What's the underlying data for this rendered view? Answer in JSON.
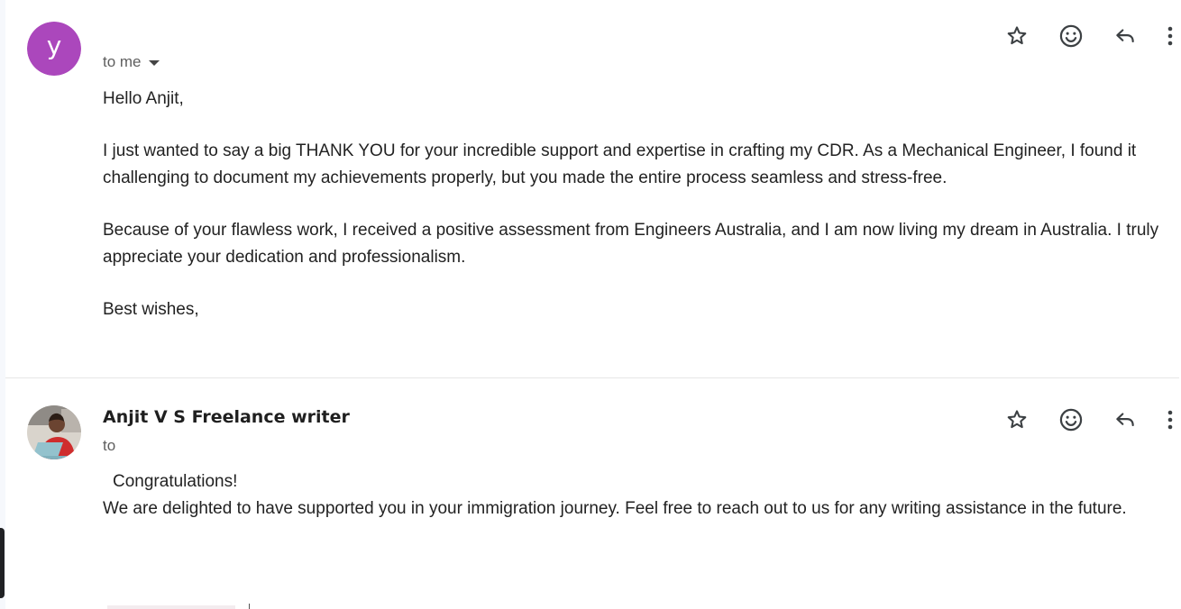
{
  "colors": {
    "avatar_bg": "#ab47bc",
    "icon": "#3c4043"
  },
  "messages": [
    {
      "avatar_letter": "y",
      "sender": "",
      "recipient": "to me",
      "icons": [
        "star-icon",
        "emoji-icon",
        "reply-icon",
        "more-vert-icon"
      ],
      "greeting": "Hello Anjit,",
      "paragraph_1": "I just wanted to say a big THANK YOU for your incredible support and expertise in crafting my CDR. As a Mechanical Engineer, I found it challenging to document my achievements properly, but you made the entire process seamless and stress-free.",
      "paragraph_2": "Because of your flawless work, I received a positive assessment from Engineers Australia, and I am now living my dream in Australia. I truly appreciate your dedication and professionalism.",
      "signoff": "Best wishes,"
    },
    {
      "sender": "Anjit V S Freelance writer",
      "recipient": "to",
      "icons": [
        "star-icon",
        "emoji-icon",
        "reply-icon",
        "more-vert-icon"
      ],
      "line_1": "Congratulations!",
      "line_2": "We are delighted to have supported you in your immigration journey. Feel free to reach out to us for any writing assistance in the future."
    }
  ]
}
